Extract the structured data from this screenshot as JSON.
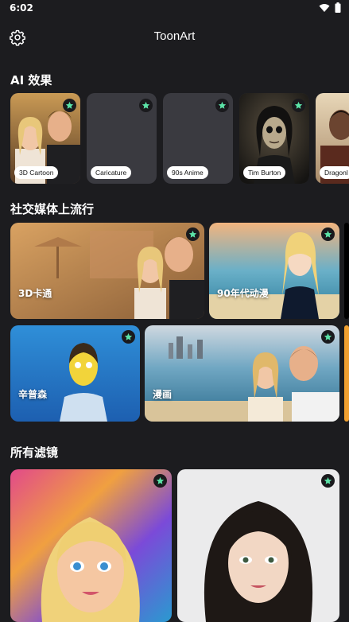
{
  "status": {
    "time": "6:02"
  },
  "app": {
    "title": "ToonArt"
  },
  "sections": {
    "ai_effects": "AI 效果",
    "trending": "社交媒体上流行",
    "all_filters": "所有滤镜"
  },
  "effects": [
    {
      "label": "3D Cartoon",
      "pro": true
    },
    {
      "label": "Caricature",
      "pro": true
    },
    {
      "label": "90s Anime",
      "pro": true
    },
    {
      "label": "Tim Burton",
      "pro": true
    },
    {
      "label": "Dragonl",
      "pro": false
    }
  ],
  "trending": [
    {
      "label": "3D卡通",
      "pro": true
    },
    {
      "label": "90年代动漫",
      "pro": true
    },
    {
      "label": "辛普森",
      "pro": true
    },
    {
      "label": "漫画",
      "pro": true
    }
  ],
  "filters": [
    {
      "pro": true
    },
    {
      "pro": true
    }
  ],
  "colors": {
    "background": "#1c1c1f",
    "card_placeholder": "#3a3a40",
    "star_badge_bg": "#1a1a1d",
    "star_accent": "#5be3a7"
  },
  "icons": {
    "settings": "gear-icon",
    "pro_badge": "star-icon",
    "wifi": "wifi-icon",
    "battery": "battery-icon"
  }
}
